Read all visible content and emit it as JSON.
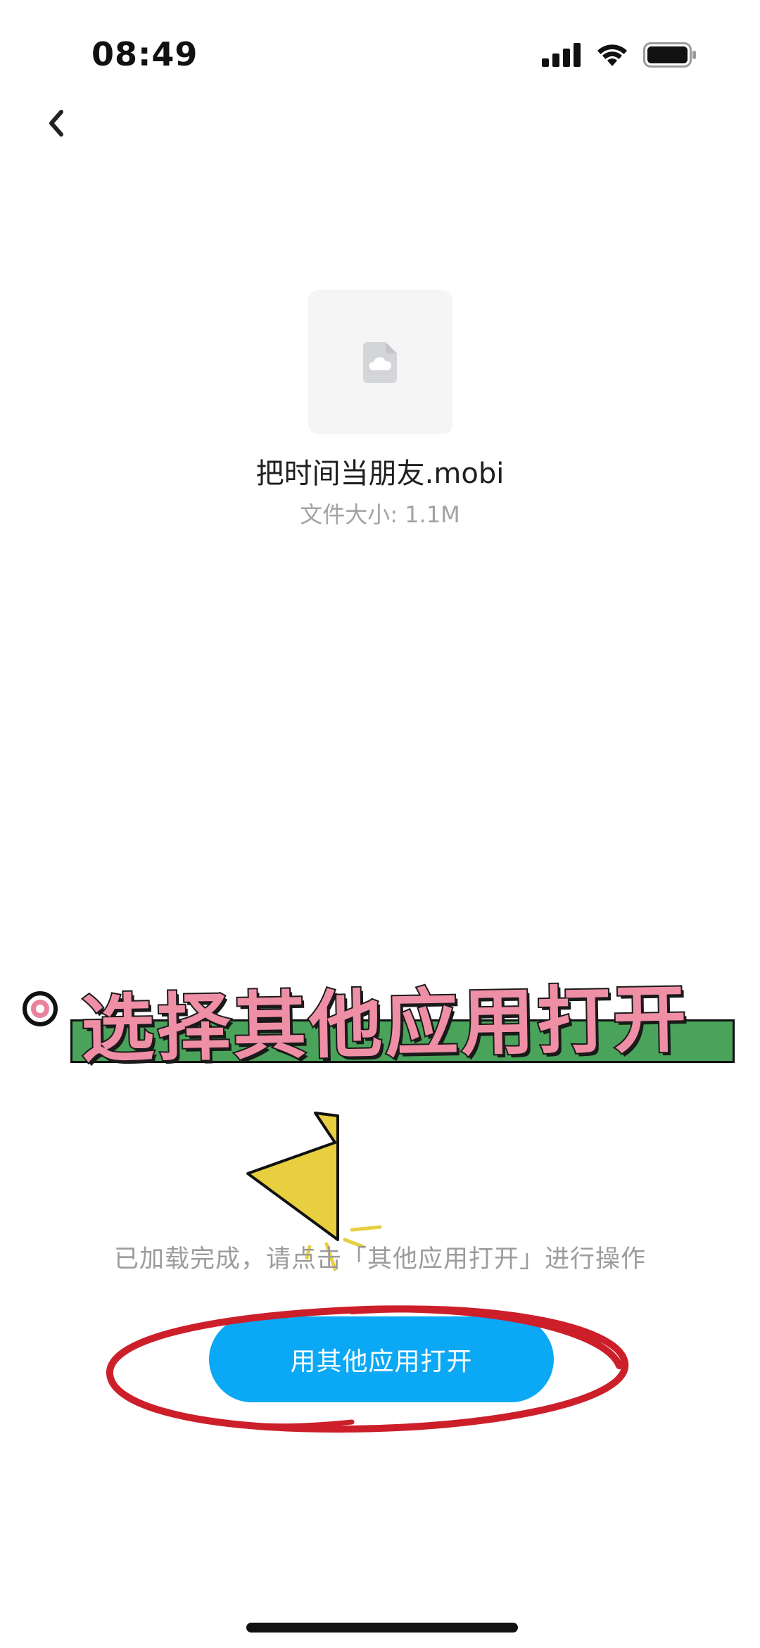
{
  "status_bar": {
    "time": "08:49",
    "signal_icon": "cellular-signal-icon",
    "wifi_icon": "wifi-icon",
    "battery_icon": "battery-icon"
  },
  "nav": {
    "back_icon": "chevron-left-icon"
  },
  "file": {
    "icon": "cloud-file-icon",
    "name": "把时间当朋友.mobi",
    "size_text": "文件大小: 1.1M"
  },
  "annotation": {
    "banner_text": "选择其他应用打开",
    "banner_color": "#ef8fa6",
    "banner_bar_color": "#4aa35a",
    "arrow_color": "#e8cf3f",
    "circle_color": "#cc1f2a"
  },
  "hint": {
    "text": "已加载完成，请点击「其他应用打开」进行操作"
  },
  "actions": {
    "open_with_label": "用其他应用打开",
    "accent_color": "#0ba8f5"
  }
}
